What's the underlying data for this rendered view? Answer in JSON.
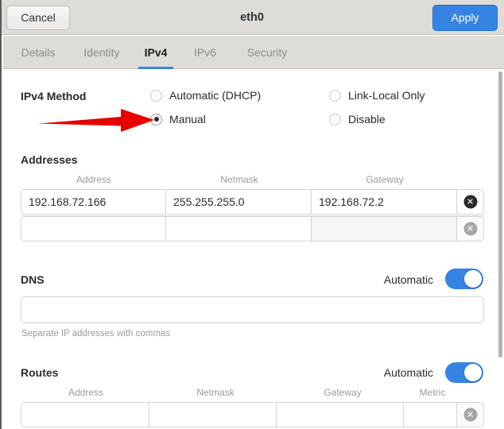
{
  "window": {
    "title": "eth0",
    "cancel_label": "Cancel",
    "apply_label": "Apply",
    "accent_color": "#3584e4",
    "header_bg": "#dfdcd8"
  },
  "tabs": [
    {
      "label": "Details",
      "active": false
    },
    {
      "label": "Identity",
      "active": false
    },
    {
      "label": "IPv4",
      "active": true
    },
    {
      "label": "IPv6",
      "active": false
    },
    {
      "label": "Security",
      "active": false
    }
  ],
  "ipv4_method": {
    "label": "IPv4 Method",
    "options": [
      {
        "label": "Automatic (DHCP)",
        "selected": false
      },
      {
        "label": "Manual",
        "selected": true
      },
      {
        "label": "Link-Local Only",
        "selected": false
      },
      {
        "label": "Disable",
        "selected": false
      }
    ]
  },
  "addresses": {
    "label": "Addresses",
    "columns": [
      "Address",
      "Netmask",
      "Gateway"
    ],
    "rows": [
      {
        "address": "192.168.72.166",
        "netmask": "255.255.255.0",
        "gateway": "192.168.72.2",
        "empty": false
      },
      {
        "address": "",
        "netmask": "",
        "gateway": "",
        "empty": true
      }
    ],
    "delete_icon": "✕"
  },
  "dns": {
    "label": "DNS",
    "automatic_label": "Automatic",
    "automatic_on": true,
    "value": "",
    "hint": "Separate IP addresses with commas"
  },
  "routes": {
    "label": "Routes",
    "automatic_label": "Automatic",
    "automatic_on": true,
    "columns": [
      "Address",
      "Netmask",
      "Gateway",
      "Metric"
    ],
    "rows": [
      {
        "address": "",
        "netmask": "",
        "gateway": "",
        "metric": "",
        "empty": true
      }
    ],
    "delete_icon": "✕"
  },
  "annotation": {
    "type": "arrow",
    "color": "#e60000",
    "points_to": "Manual"
  }
}
